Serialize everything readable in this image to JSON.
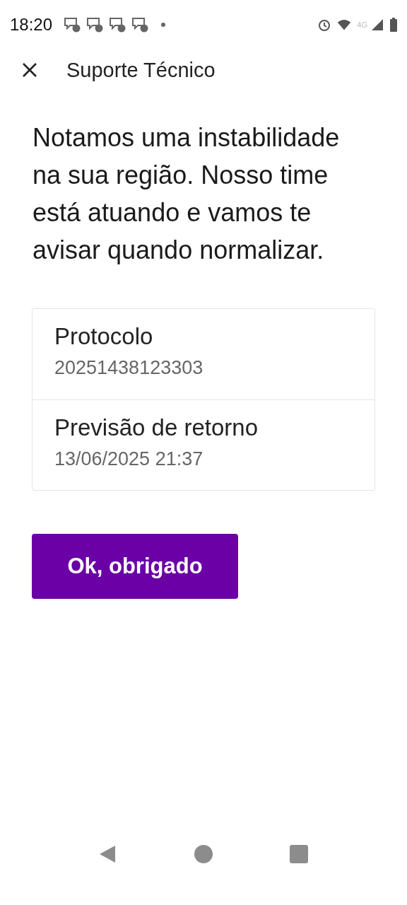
{
  "status_bar": {
    "time": "18:20",
    "notifications": [
      {
        "kind": "chat"
      },
      {
        "kind": "chat"
      },
      {
        "kind": "chat"
      },
      {
        "kind": "chat"
      }
    ],
    "network": "4G"
  },
  "header": {
    "title": "Suporte Técnico"
  },
  "message": "Notamos uma instabilidade na sua região. Nosso time está atuando e vamos te avisar quando normalizar.",
  "details": [
    {
      "label": "Protocolo",
      "value": "20251438123303"
    },
    {
      "label": "Previsão de retorno",
      "value": "13/06/2025 21:37"
    }
  ],
  "button": "Ok, obrigado"
}
